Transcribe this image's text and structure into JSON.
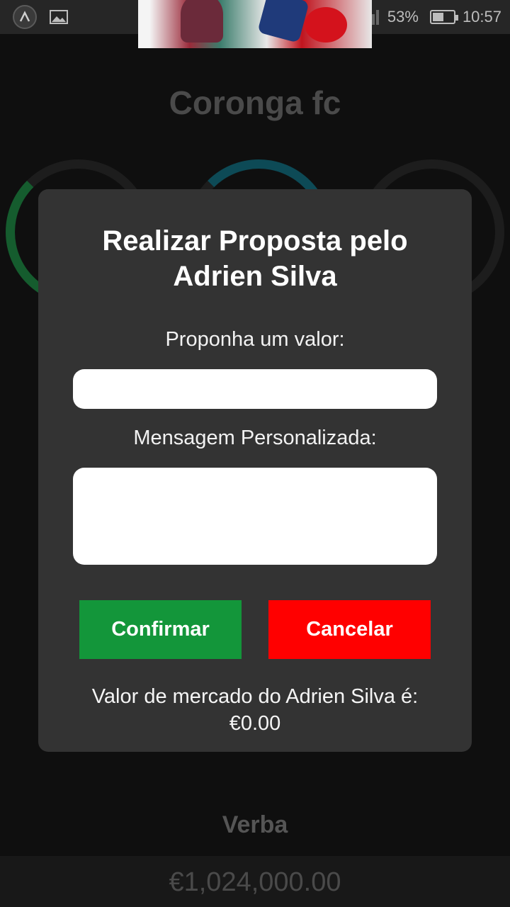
{
  "status_bar": {
    "battery": "53%",
    "time": "10:57",
    "battery_level": 0.53,
    "icons": [
      "app-logo-icon",
      "image-icon",
      "add-circle-icon",
      "wifi-icon",
      "signal-icon",
      "battery-icon"
    ]
  },
  "background": {
    "team_name": "Coronga fc",
    "budget_label": "Verba",
    "budget_value": "€1,024,000.00"
  },
  "modal": {
    "title": "Realizar Proposta pelo Adrien Silva",
    "value_label": "Proponha um valor:",
    "value_input": "",
    "message_label": "Mensagem Personalizada:",
    "message_input": "",
    "confirm_label": "Confirmar",
    "cancel_label": "Cancelar",
    "market_value_text": "Valor de mercado do Adrien Silva é:",
    "market_value": "€0.00"
  },
  "colors": {
    "modal_bg": "#333333",
    "confirm": "#13963a",
    "cancel": "#ff0000"
  }
}
